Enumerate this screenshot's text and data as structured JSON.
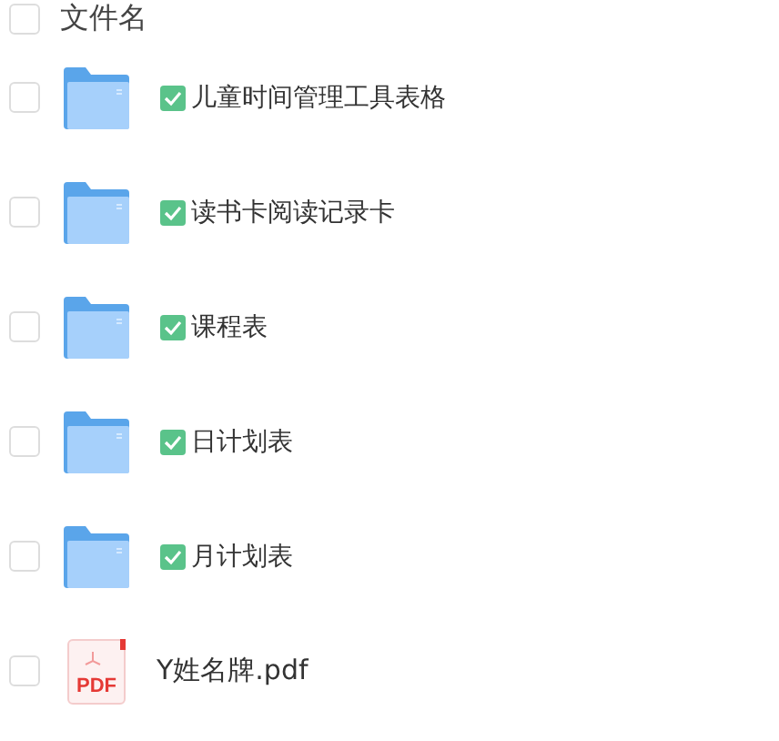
{
  "header": {
    "label": "文件名",
    "checked": false
  },
  "files": [
    {
      "kind": "folder",
      "name": "儿童时间管理工具表格",
      "tagged": true,
      "checked": false
    },
    {
      "kind": "folder",
      "name": "读书卡阅读记录卡",
      "tagged": true,
      "checked": false
    },
    {
      "kind": "folder",
      "name": "课程表",
      "tagged": true,
      "checked": false
    },
    {
      "kind": "folder",
      "name": "日计划表",
      "tagged": true,
      "checked": false
    },
    {
      "kind": "folder",
      "name": "月计划表",
      "tagged": true,
      "checked": false
    },
    {
      "kind": "pdf",
      "name": "Y姓名牌.pdf",
      "tagged": false,
      "checked": false,
      "icon_label": "PDF"
    }
  ]
}
